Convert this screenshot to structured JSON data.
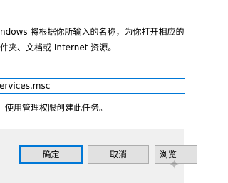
{
  "dialog": {
    "description_line1": "ndows 将根据你所输入的名称，为你打开相应的",
    "description_line2": "件夹、文档或 Internet 资源。",
    "open_value": "ervices.msc",
    "admin_label": "使用管理权限创建此任务。"
  },
  "buttons": {
    "ok": "确定",
    "cancel": "取消",
    "browse": "浏览"
  },
  "colors": {
    "accent": "#0078d7",
    "footer_bg": "#f0f0f0",
    "button_bg": "#e1e1e1",
    "button_border": "#adadad"
  },
  "icons": {
    "watermark": "star-icon"
  }
}
